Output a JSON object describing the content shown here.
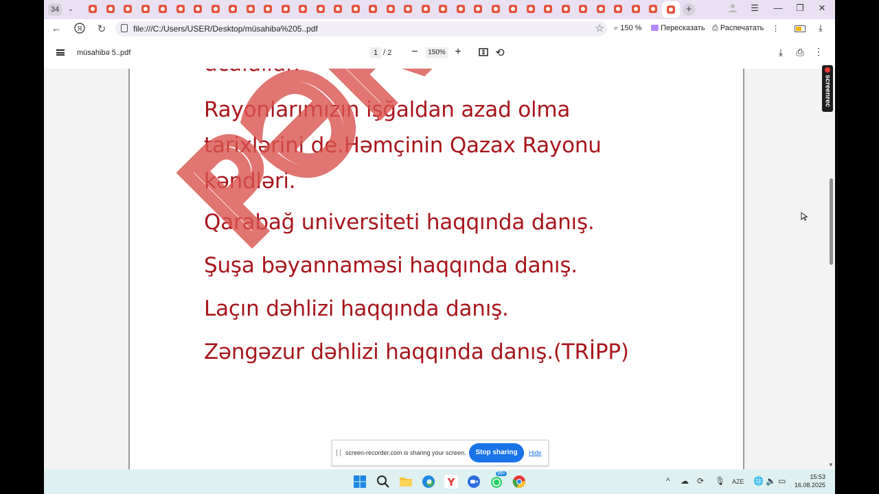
{
  "tabs": {
    "count": "34",
    "dropdown": "⌄"
  },
  "window": {
    "minimize": "—",
    "restore": "❐",
    "close": "✕",
    "menu": "☰"
  },
  "address": {
    "url": "file:///C:/Users/USER/Desktop/müsahibə%205..pdf",
    "zoom": "150 %",
    "retell": "Пересказать",
    "print": "Распечатать"
  },
  "pdf": {
    "filename": "müsahibə 5..pdf",
    "page_current": "1",
    "page_total": "/ 2",
    "zoom": "150%"
  },
  "document": {
    "lines": [
      "ucaldıldı?",
      "Rayonlarımızın işğaldan azad olma",
      "tarixlərini de.Həmçinin Qazax Rayonu",
      "kəndləri.",
      "Qarabağ universiteti haqqında danış.",
      "Şuşa bəyannaməsi haqqında danış.",
      "Laçın dəhlizi haqqında danış.",
      "Zəngəzur dəhlizi haqqında danış.(TRİPP)"
    ],
    "watermark": "PƏRİ HƏ"
  },
  "screenrec": {
    "label": "screenrec"
  },
  "sharing": {
    "message": "screen-recorder.com is sharing your screen.",
    "stop": "Stop sharing",
    "hide": "Hide"
  },
  "taskbar": {
    "lang": "AZE",
    "time": "15:53",
    "date": "16.08.2025",
    "whatsapp_badge": "99+"
  },
  "colors": {
    "doc_text": "#a8151b",
    "watermark": "#d9534f",
    "stop_button": "#1a73e8",
    "taskbar": "#dff0f0"
  }
}
